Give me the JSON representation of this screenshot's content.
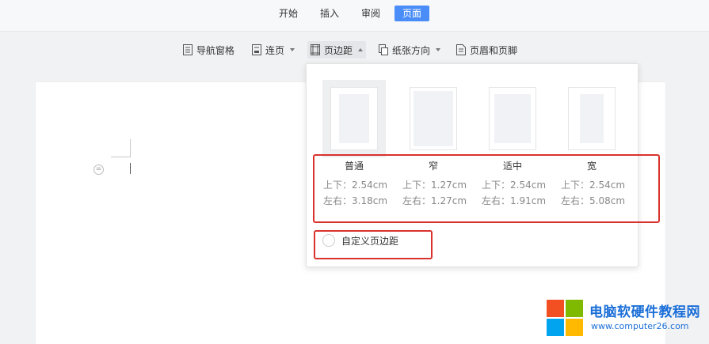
{
  "menubar": {
    "tabs": [
      {
        "label": "开始",
        "active": false
      },
      {
        "label": "插入",
        "active": false
      },
      {
        "label": "审阅",
        "active": false
      },
      {
        "label": "页面",
        "active": true
      }
    ]
  },
  "toolbar": {
    "nav_pane": "导航窗格",
    "continuous_page": "连页",
    "margins": "页边距",
    "orientation": "纸张方向",
    "header_footer": "页眉和页脚"
  },
  "margins_dropdown": {
    "options": [
      {
        "name": "普通",
        "top_bottom": "上下：2.54cm",
        "left_right": "左右：3.18cm",
        "selected": true
      },
      {
        "name": "窄",
        "top_bottom": "上下：1.27cm",
        "left_right": "左右：1.27cm",
        "selected": false
      },
      {
        "name": "适中",
        "top_bottom": "上下：2.54cm",
        "left_right": "左右：1.91cm",
        "selected": false
      },
      {
        "name": "宽",
        "top_bottom": "上下：2.54cm",
        "left_right": "左右：5.08cm",
        "selected": false
      }
    ],
    "custom_label": "自定义页边距"
  },
  "watermark": {
    "title": "电脑软硬件教程网",
    "url": "www.computer26.com"
  },
  "colors": {
    "accent": "#4a8df8",
    "highlight_box": "#d9322c",
    "watermark_blue": "#1b6fd8"
  }
}
